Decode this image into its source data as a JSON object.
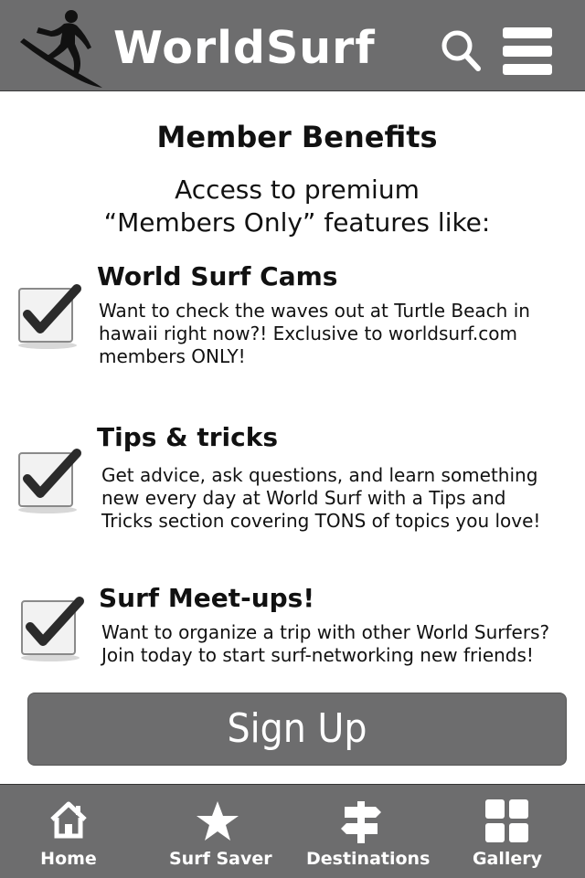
{
  "header": {
    "brand": "WorldSurf",
    "logo_icon": "surfer-icon",
    "search_icon": "search-icon",
    "menu_icon": "hamburger-menu-icon"
  },
  "main": {
    "title": "Member Benefits",
    "intro_line1": "Access to premium",
    "intro_line2": "“Members Only” features like:",
    "benefits": [
      {
        "title": "World Surf Cams",
        "desc_line1": "Want to check the waves out at Turtle Beach in",
        "desc_line2": "hawaii right now?! Exclusive to worldsurf.com",
        "desc_line3": "members ONLY!",
        "checked": true
      },
      {
        "title": "Tips & tricks",
        "desc_line1": "Get advice, ask questions, and learn something",
        "desc_line2": "new every day at World Surf with a Tips and",
        "desc_line3": "Tricks section covering TONS of topics you love!",
        "checked": true
      },
      {
        "title": "Surf Meet-ups!",
        "desc_line1": "Want to organize a trip with other World Surfers?",
        "desc_line2": "Join today to start surf-networking new friends!",
        "checked": true
      }
    ],
    "signup_label": "Sign Up"
  },
  "footer": {
    "tabs": [
      {
        "label": "Home",
        "icon": "home-icon"
      },
      {
        "label": "Surf Saver",
        "icon": "star-icon"
      },
      {
        "label": "Destinations",
        "icon": "signpost-icon"
      },
      {
        "label": "Gallery",
        "icon": "grid-icon"
      }
    ]
  },
  "colors": {
    "bar_gray": "#6d6d6e",
    "text": "#111111",
    "checkbox_fill": "#f2f2f2",
    "check_mark": "#2b2b2b"
  }
}
